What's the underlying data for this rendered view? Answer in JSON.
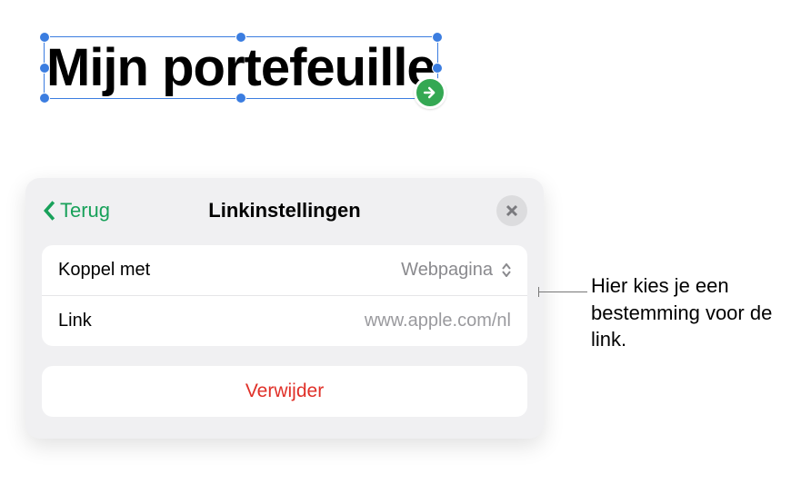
{
  "title": {
    "text": "Mijn portefeuille"
  },
  "popover": {
    "back_label": "Terug",
    "title": "Linkinstellingen",
    "rows": {
      "koppel_label": "Koppel met",
      "koppel_value": "Webpagina",
      "link_label": "Link",
      "link_value": "www.apple.com/nl"
    },
    "delete_label": "Verwijder"
  },
  "annotation": {
    "text": "Hier kies je een bestemming voor de link."
  },
  "colors": {
    "accent_green": "#18a15a",
    "badge_green": "#34a853",
    "selection_blue": "#3b7de0",
    "destructive_red": "#e03028"
  }
}
